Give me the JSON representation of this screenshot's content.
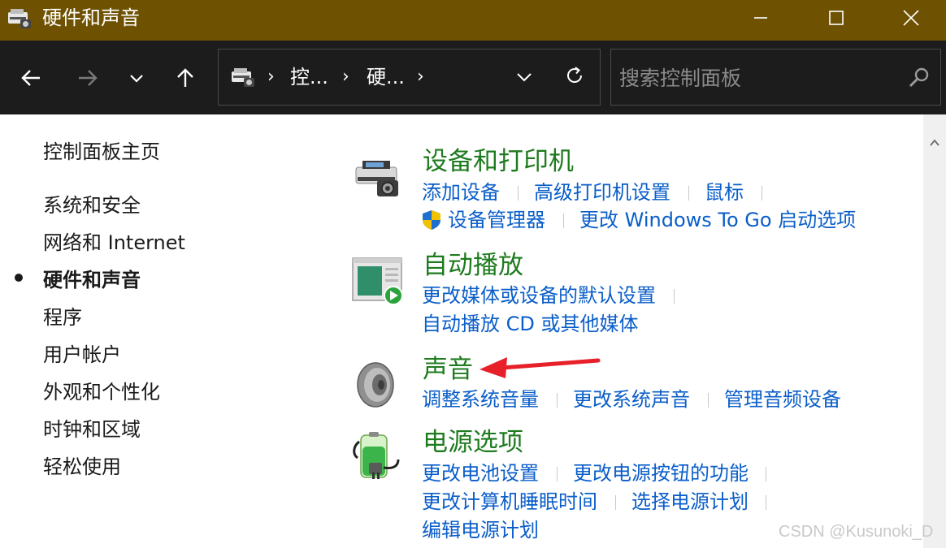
{
  "window": {
    "title": "硬件和声音"
  },
  "nav": {
    "breadcrumbs": [
      "控...",
      "硬..."
    ],
    "search_placeholder": "搜索控制面板"
  },
  "sidebar": {
    "items": [
      {
        "label": "控制面板主页",
        "active": false
      },
      {
        "label": "系统和安全",
        "active": false
      },
      {
        "label": "网络和 Internet",
        "active": false
      },
      {
        "label": "硬件和声音",
        "active": true
      },
      {
        "label": "程序",
        "active": false
      },
      {
        "label": "用户帐户",
        "active": false
      },
      {
        "label": "外观和个性化",
        "active": false
      },
      {
        "label": "时钟和区域",
        "active": false
      },
      {
        "label": "轻松使用",
        "active": false
      }
    ]
  },
  "categories": [
    {
      "title": "设备和打印机",
      "icon": "printer-camera-icon",
      "links": [
        "添加设备",
        "高级打印机设置",
        "鼠标",
        "设备管理器",
        "更改 Windows To Go 启动选项"
      ]
    },
    {
      "title": "自动播放",
      "icon": "autoplay-icon",
      "links": [
        "更改媒体或设备的默认设置",
        "自动播放 CD 或其他媒体"
      ]
    },
    {
      "title": "声音",
      "icon": "speaker-icon",
      "links": [
        "调整系统音量",
        "更改系统声音",
        "管理音频设备"
      ]
    },
    {
      "title": "电源选项",
      "icon": "battery-plug-icon",
      "links": [
        "更改电池设置",
        "更改电源按钮的功能",
        "更改计算机睡眠时间",
        "选择电源计划",
        "编辑电源计划"
      ]
    }
  ],
  "watermark": "CSDN @Kusunoki_D",
  "colors": {
    "titlebar": "#6e5202",
    "navbar": "#1c1c1c",
    "category_title": "#1e7b1e",
    "link": "#0a5ec9",
    "annotation_arrow": "#e8202a"
  }
}
